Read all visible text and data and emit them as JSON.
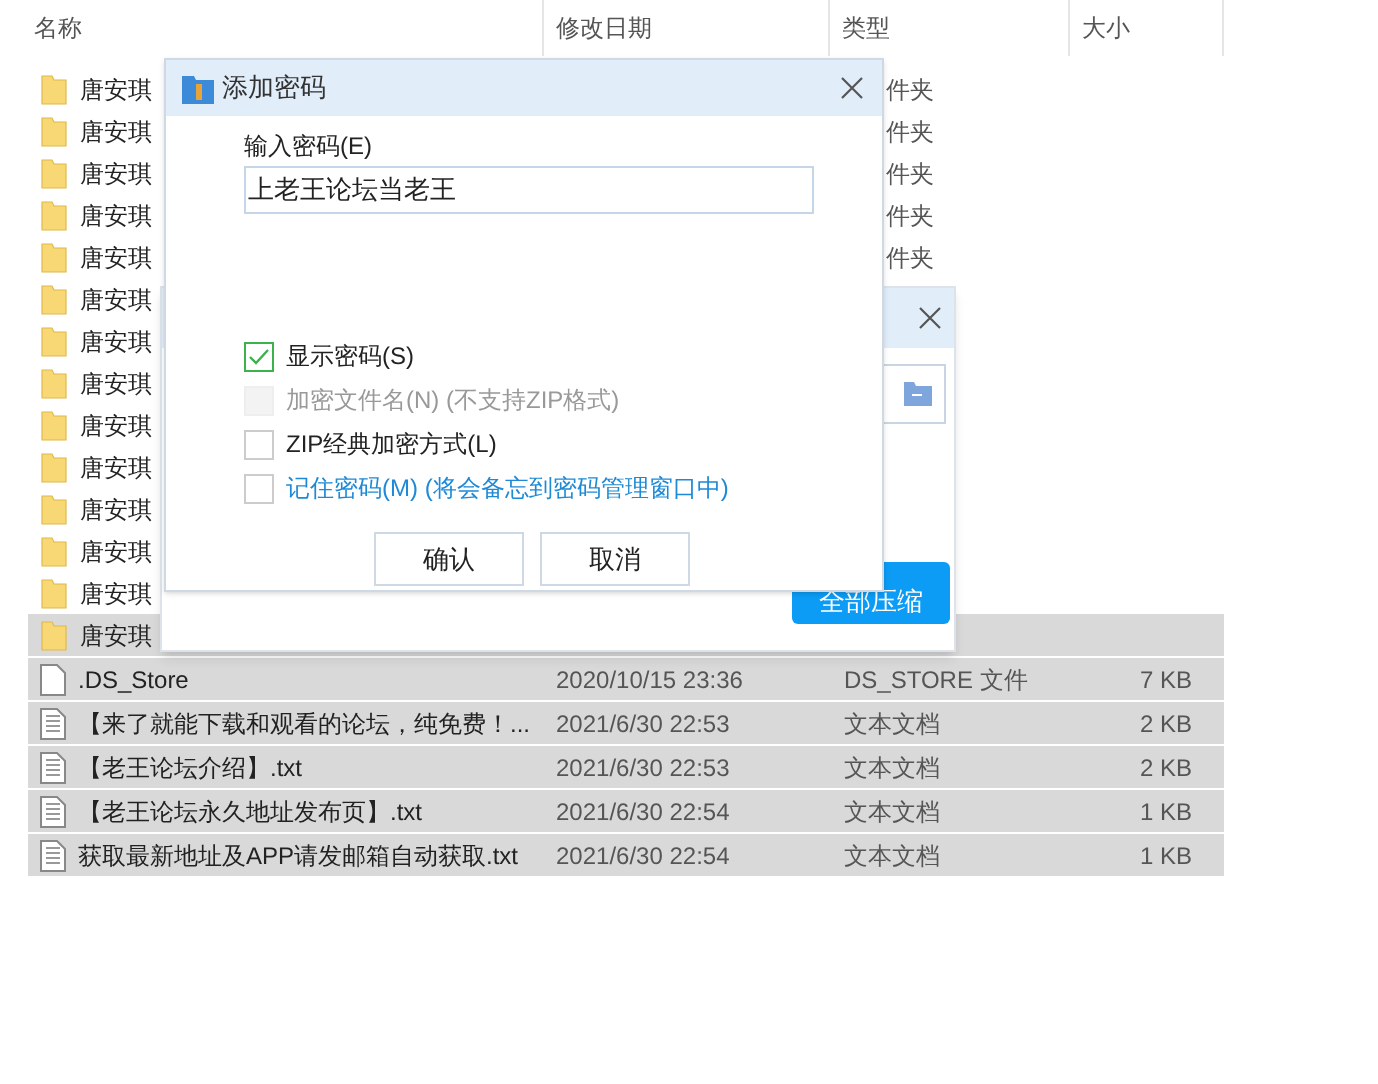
{
  "explorer": {
    "columns": [
      "名称",
      "修改日期",
      "类型",
      "大小"
    ],
    "folders": [
      {
        "name": "唐安琪",
        "type": "件夹",
        "selected": false
      },
      {
        "name": "唐安琪",
        "type": "件夹",
        "selected": false
      },
      {
        "name": "唐安琪",
        "type": "件夹",
        "selected": false
      },
      {
        "name": "唐安琪",
        "type": "件夹",
        "selected": false
      },
      {
        "name": "唐安琪",
        "type": "件夹",
        "selected": false
      },
      {
        "name": "唐安琪",
        "selected": false
      },
      {
        "name": "唐安琪",
        "selected": false
      },
      {
        "name": "唐安琪",
        "selected": false
      },
      {
        "name": "唐安琪",
        "selected": false
      },
      {
        "name": "唐安琪",
        "selected": false
      },
      {
        "name": "唐安琪",
        "selected": false
      },
      {
        "name": "唐安琪",
        "selected": false
      },
      {
        "name": "唐安琪",
        "selected": false
      },
      {
        "name": "唐安琪",
        "selected": true
      }
    ],
    "files": [
      {
        "kind": "blank",
        "name": ".DS_Store",
        "date": "2020/10/15 23:36",
        "type": "DS_STORE 文件",
        "size": "7 KB",
        "selected": true
      },
      {
        "kind": "text",
        "name": "【来了就能下载和观看的论坛，纯免费！...",
        "date": "2021/6/30 22:53",
        "type": "文本文档",
        "size": "2 KB",
        "selected": true
      },
      {
        "kind": "text",
        "name": "【老王论坛介绍】.txt",
        "date": "2021/6/30 22:53",
        "type": "文本文档",
        "size": "2 KB",
        "selected": true
      },
      {
        "kind": "text",
        "name": "【老王论坛永久地址发布页】.txt",
        "date": "2021/6/30 22:54",
        "type": "文本文档",
        "size": "1 KB",
        "selected": true
      },
      {
        "kind": "text",
        "name": "获取最新地址及APP请发邮箱自动获取.txt",
        "date": "2021/6/30 22:54",
        "type": "文本文档",
        "size": "1 KB",
        "selected": true
      }
    ]
  },
  "back_dialog": {
    "button": "全部压缩"
  },
  "dialog": {
    "title": "添加密码",
    "field_label": "输入密码(E)",
    "value": "上老王论坛当老王",
    "options": [
      {
        "kind": "plain",
        "label": "显示密码(S)",
        "checked": true,
        "disabled": false
      },
      {
        "kind": "plain",
        "label": "加密文件名(N) (不支持ZIP格式)",
        "checked": false,
        "disabled": true
      },
      {
        "kind": "plain",
        "label": "ZIP经典加密方式(L)",
        "checked": false,
        "disabled": false
      },
      {
        "kind": "link",
        "label": "记住密码(M) (将会备忘到密码管理窗口中)",
        "checked": false,
        "disabled": false
      }
    ],
    "buttons": [
      "确认",
      "取消"
    ]
  }
}
